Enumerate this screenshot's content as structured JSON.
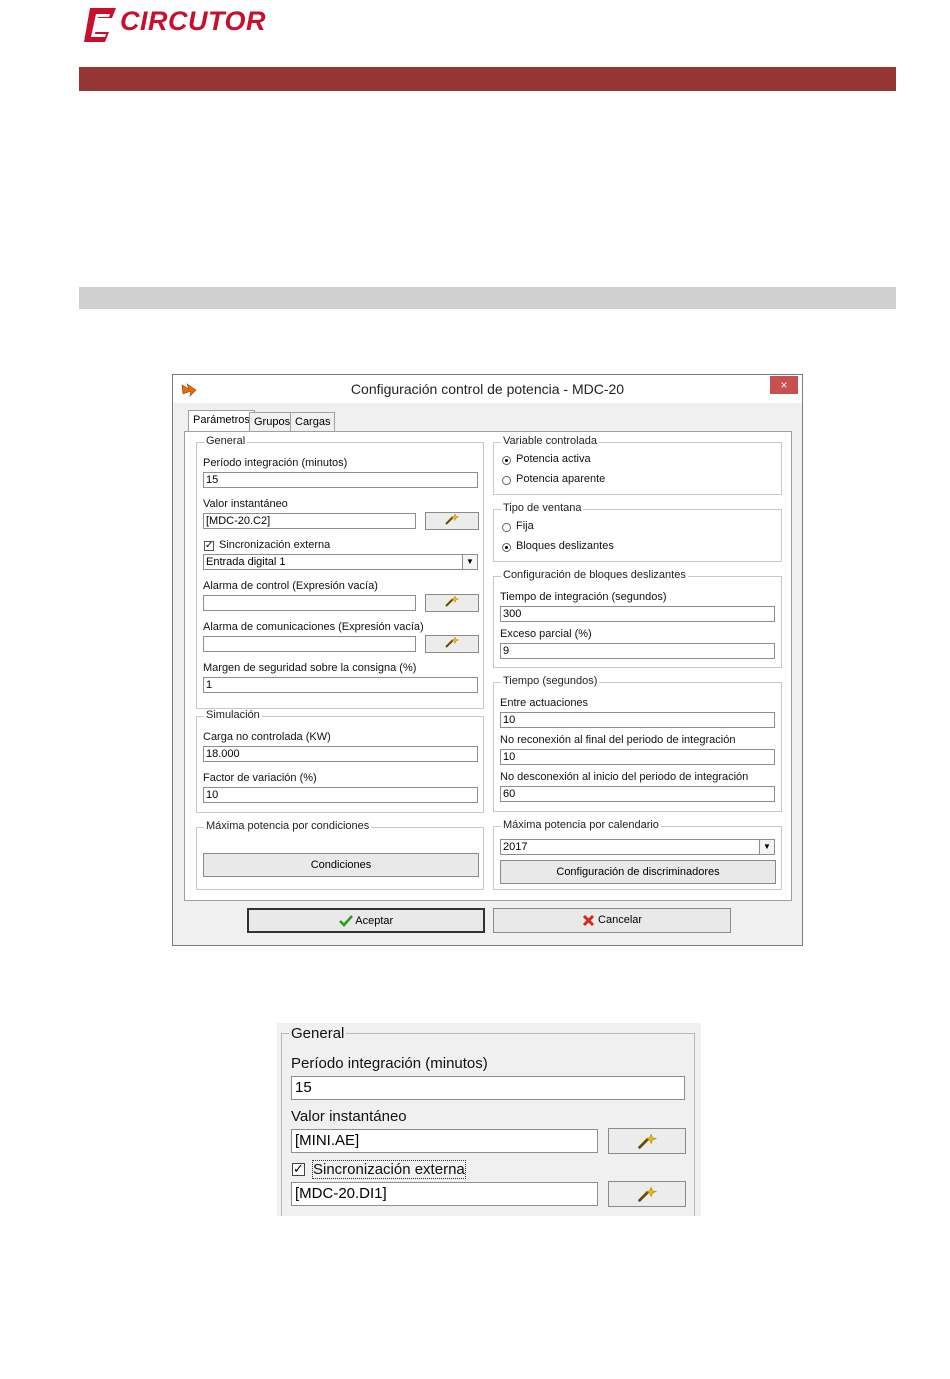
{
  "header": {
    "brand": "CIRCUTOR",
    "brand_color": "#c8102e",
    "band_color": "#943634",
    "subband_color": "#d0d0d0"
  },
  "dialog": {
    "title": "Configuración control de potencia - MDC-20",
    "close_label": "×",
    "tabs": [
      "Parámetros",
      "Grupos",
      "Cargas"
    ],
    "general": {
      "title": "General",
      "periodo_label": "Período integración (minutos)",
      "periodo_value": "15",
      "valor_label": "Valor instantáneo",
      "valor_value": "[MDC-20.C2]",
      "sync_label": "Sincronización externa",
      "sync_checked": true,
      "sync_select": "Entrada digital 1",
      "alarma_control_label": "Alarma de control (Expresión vacía)",
      "alarma_control_value": "",
      "alarma_com_label": "Alarma de comunicaciones (Expresión vacía)",
      "alarma_com_value": "",
      "margen_label": "Margen de seguridad sobre la consigna (%)",
      "margen_value": "1"
    },
    "simulacion": {
      "title": "Simulación",
      "carga_label": "Carga no controlada (KW)",
      "carga_value": "18.000",
      "factor_label": "Factor de variación (%)",
      "factor_value": "10"
    },
    "maxima_condiciones": {
      "title": "Máxima potencia por condiciones",
      "button": "Condiciones"
    },
    "variable": {
      "title": "Variable controlada",
      "options": [
        "Potencia activa",
        "Potencia aparente"
      ],
      "selected": "Potencia activa"
    },
    "ventana": {
      "title": "Tipo de ventana",
      "options": [
        "Fija",
        "Bloques deslizantes"
      ],
      "selected": "Bloques deslizantes"
    },
    "bloques": {
      "title": "Configuración de bloques deslizantes",
      "tiempo_label": "Tiempo de integración (segundos)",
      "tiempo_value": "300",
      "exceso_label": "Exceso parcial (%)",
      "exceso_value": "9"
    },
    "tiempo": {
      "title": "Tiempo (segundos)",
      "entre_label": "Entre actuaciones",
      "entre_value": "10",
      "noreconexion_label": "No reconexión al final del periodo de integración",
      "noreconexion_value": "10",
      "nodesconexion_label": "No desconexión al inicio del periodo de integración",
      "nodesconexion_value": "60"
    },
    "maxima_calendario": {
      "title": "Máxima potencia por calendario",
      "year": "2017",
      "button": "Configuración de discriminadores"
    },
    "ok_label": "Aceptar",
    "cancel_label": "Cancelar"
  },
  "zoom": {
    "title": "General",
    "periodo_label": "Período integración (minutos)",
    "periodo_value": "15",
    "valor_label": "Valor instantáneo",
    "valor_value": "[MINI.AE]",
    "sync_label": "Sincronización externa",
    "sync_checked": true,
    "sync_value": "[MDC-20.DI1]"
  },
  "icons": {
    "app": "power-control-icon",
    "wand": "magic-wand-icon",
    "ok": "green-checkmark-icon",
    "cancel": "red-x-icon"
  }
}
